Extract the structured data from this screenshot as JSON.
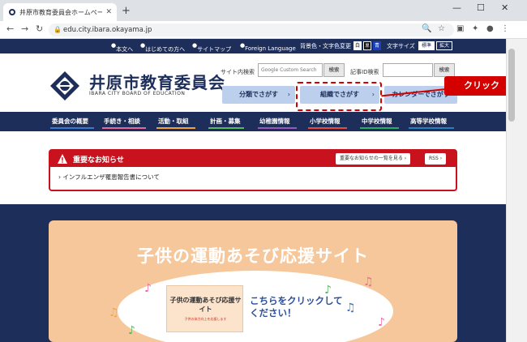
{
  "browser": {
    "tab_title": "井原市教育委員会ホームページ トップ",
    "url": "edu.city.ibara.okayama.jp"
  },
  "util_bar": {
    "links": [
      "本文へ",
      "はじめての方へ",
      "サイトマップ",
      "Foreign Language"
    ],
    "color_label": "背景色・文字色変更",
    "color_boxes": [
      "白",
      "黒",
      "青"
    ],
    "font_label": "文字サイズ",
    "font_buttons": [
      "標準",
      "拡大"
    ]
  },
  "header": {
    "title": "井原市教育委員会",
    "subtitle": "IBARA CITY BOARD OF EDUCATION",
    "site_search_label": "サイト内検索",
    "site_search_placeholder": "Google Custom Search",
    "search_button": "検索",
    "id_search_label": "記事ID検索",
    "id_search_button": "検索",
    "category_buttons": [
      "分類でさがす",
      "組織でさがす",
      "カレンダーでさがす"
    ]
  },
  "callout": {
    "label": "クリック"
  },
  "global_nav": [
    "委員会の概要",
    "手続き・相談",
    "活動・取組",
    "計画・募集",
    "幼稚園情報",
    "小学校情報",
    "中学校情報",
    "高等学校情報"
  ],
  "notice": {
    "title": "重要なお知らせ",
    "list_button": "重要なお知らせの一覧を見る",
    "rss_button": "RSS",
    "items": [
      "インフルエンザ罹患報告書について"
    ]
  },
  "banner": {
    "title": "子供の運動あそび応援サイト",
    "card_title": "子供の運動あそび応援サイト",
    "card_sub": "子供の体力向上を応援します",
    "cta": "こちらをクリックしてください！"
  },
  "colors": {
    "navy": "#1e2e5a",
    "accent_red": "#c8131e",
    "category_blue": "#bcd0ee",
    "banner_orange": "#f6c79a"
  }
}
